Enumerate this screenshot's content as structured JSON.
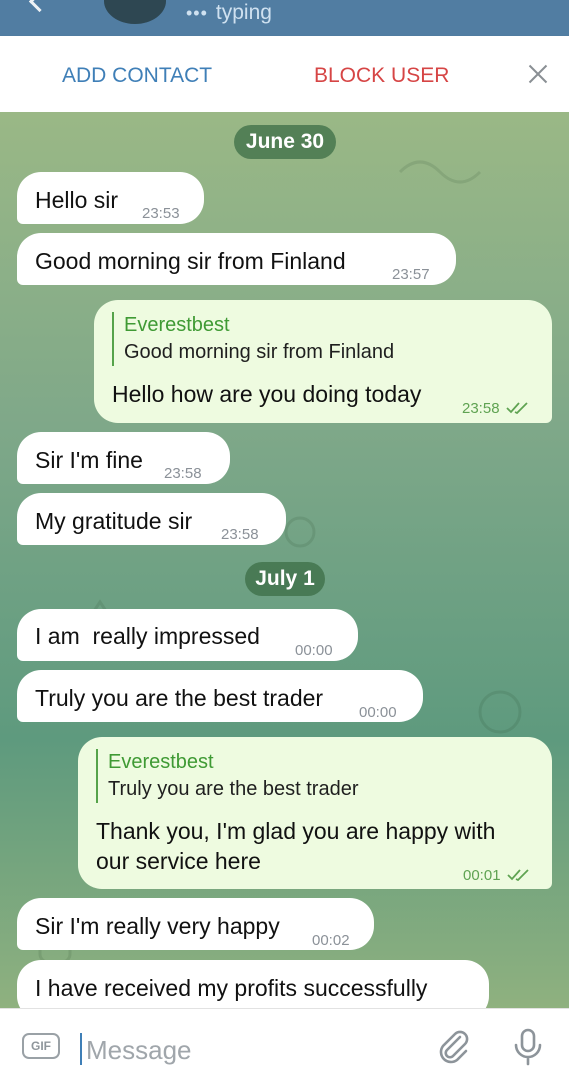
{
  "header": {
    "status": "typing",
    "back_icon": "back-arrow-icon",
    "avatar": "contact-avatar"
  },
  "actionbar": {
    "add_contact": "ADD CONTACT",
    "block_user": "BLOCK USER",
    "close_icon": "close-icon"
  },
  "colors": {
    "header": "#517da2",
    "accent": "#3f7fb7",
    "danger": "#d64545",
    "outgoing": "#eefbe0",
    "incoming": "#ffffff",
    "check": "#5fa352"
  },
  "dates": {
    "d1": "June 30",
    "d2": "July 1"
  },
  "messages": {
    "m1": {
      "text": "Hello sir",
      "time": "23:53"
    },
    "m2": {
      "text": "Good morning sir from Finland",
      "time": "23:57"
    },
    "m3": {
      "reply_name": "Everestbest",
      "reply_text": "Good morning sir from Finland",
      "text": "Hello how are you doing today",
      "time": "23:58"
    },
    "m4": {
      "text": "Sir I'm fine",
      "time": "23:58"
    },
    "m5": {
      "text": "My gratitude sir",
      "time": "23:58"
    },
    "m6": {
      "text": "I am  really impressed",
      "time": "00:00"
    },
    "m7": {
      "text": "Truly you are the best trader",
      "time": "00:00"
    },
    "m8": {
      "reply_name": "Everestbest",
      "reply_text": "Truly you are the best trader",
      "text_line1": "Thank you, I'm glad you are happy with",
      "text_line2": "our service here",
      "time": "00:01"
    },
    "m9": {
      "text": "Sir I'm really very happy",
      "time": "00:02"
    },
    "m10": {
      "text": "I have received my profits successfully"
    }
  },
  "input": {
    "gif_label": "GIF",
    "placeholder": "Message",
    "attach_icon": "paperclip-icon",
    "mic_icon": "microphone-icon"
  }
}
